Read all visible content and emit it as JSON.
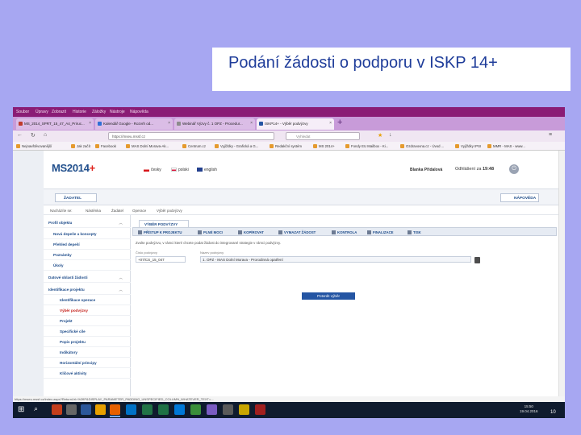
{
  "slide": {
    "title": "Podání žádosti o podporu v ISKP 14+",
    "page_number": "10"
  },
  "browser": {
    "menu": [
      "Soubor",
      "Úpravy",
      "Zobrazit",
      "Historie",
      "Záložky",
      "Nástroje",
      "Nápověda"
    ],
    "tabs": [
      {
        "label": "MS_2014_SPRT_15_47_A4_Priruc..."
      },
      {
        "label": "Kalendář Google - Rozvrh od..."
      },
      {
        "label": "Webinář Výzvy č. 1 OPZ - Procedur..."
      },
      {
        "label": "ISKP14+ - Výběr podvýzvy"
      }
    ],
    "url": "https://mseu.mssf.cz",
    "search_placeholder": "Vyhledat",
    "bookmarks": [
      "Nejnavštěvovanější",
      "Jak začít",
      "Facebook",
      "MAS Dolní Morava-Ak...",
      "Centrum.cz",
      "Vyjíždky - Grafická a G...",
      "Redakční systém",
      "MS 2014+",
      "Fondy EU Mailbox - Ki...",
      "Ozdravovna.cz - Úvod ...",
      "Vyjíždky IPSI",
      "MMR - MAS - www..."
    ],
    "status_url": "https://mseu.mssf.cz/index.aspx?ReturnUrl=%2fIP&DISPLAY_PARAMETER_PADDING_UNSPECIFIED_COLUMN_WHATEVER_TEXT=..."
  },
  "app": {
    "logo_main": "MS2014",
    "logo_plus": "+",
    "languages": [
      "česky",
      "polski",
      "english"
    ],
    "user_name": "Blanka Přidalová",
    "timeout_label": "Odhlášení za",
    "timeout_value": "19:48",
    "role_button": "ŽADATEL",
    "help_button": "NÁPOVĚDA",
    "breadcrumbs": [
      "Nacházíte se:",
      "Nástěnka",
      "Žadatel",
      "Operace",
      "Výběr podvýzvy"
    ],
    "sidebar": [
      {
        "label": "Profil objektu",
        "type": "section"
      },
      {
        "label": "Nová depeše a koncepty",
        "type": "item"
      },
      {
        "label": "Přehled depeší",
        "type": "item"
      },
      {
        "label": "Poznámky",
        "type": "item"
      },
      {
        "label": "Úkoly",
        "type": "item"
      },
      {
        "label": "Datové oblasti žádosti",
        "type": "section"
      },
      {
        "label": "Identifikace projektu",
        "type": "section"
      },
      {
        "label": "Identifikace operace",
        "type": "sub"
      },
      {
        "label": "Výběr podvýzvy",
        "type": "sub-active"
      },
      {
        "label": "Projekt",
        "type": "sub"
      },
      {
        "label": "Specifické cíle",
        "type": "sub"
      },
      {
        "label": "Popis projektu",
        "type": "sub"
      },
      {
        "label": "Indikátory",
        "type": "sub"
      },
      {
        "label": "Horizontální principy",
        "type": "sub"
      },
      {
        "label": "Klíčové aktivity",
        "type": "sub"
      }
    ],
    "main_tab": "VÝBĚR PODVÝZVY",
    "toolbar": [
      "PŘÍSTUP K PROJEKTU",
      "PLNÉ MOCI",
      "KOPÍROVAT",
      "VYMAZAT ŽÁDOST",
      "KONTROLA",
      "FINALIZACE",
      "TISK"
    ],
    "info_text": "Zvolte podvýzvu, v rámci které chcete podat žádost do integrované strategie v rámci podvýzvy.",
    "field1_label": "Číslo podvýzvy",
    "field1_value": "+07/CS_15_047",
    "field2_label": "Název podvýzvy",
    "field2_value": "1. OPZ - MAS Dolní Morava - Prorodinná opatření",
    "confirm_button": "Potvrdit výběr"
  },
  "taskbar": {
    "time": "15:50",
    "date": "19.04.2016"
  }
}
